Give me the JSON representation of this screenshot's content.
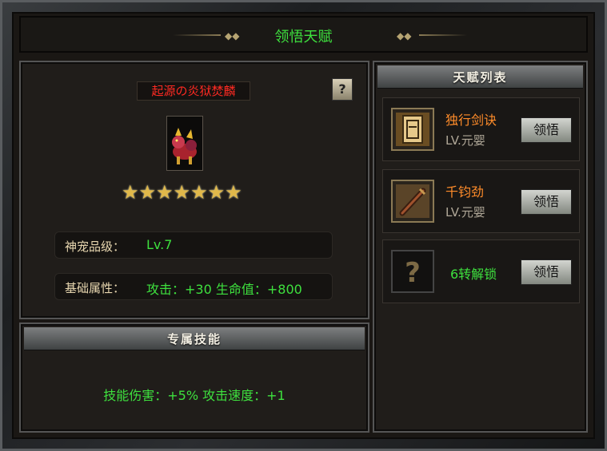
{
  "header": {
    "title": "领悟天赋"
  },
  "pet": {
    "name": "起源の炎狱焚麟",
    "stars": 7,
    "help_label": "?",
    "grade_label": "神宠品级：",
    "grade_value": "Lv.7",
    "attr_label": "基础属性：",
    "attr_value": "攻击：+30 生命值：+800"
  },
  "skill": {
    "header": "专属技能",
    "description": "技能伤害：+5% 攻击速度：+1"
  },
  "talents": {
    "header": "天赋列表",
    "items": [
      {
        "name": "独行剑诀",
        "level": "LV.元婴",
        "button": "领悟",
        "icon": "scroll-icon"
      },
      {
        "name": "千钧劲",
        "level": "LV.元婴",
        "button": "领悟",
        "icon": "sword-icon"
      },
      {
        "locked_text": "6转解锁",
        "button": "领悟",
        "icon": "question-mark-icon"
      }
    ]
  }
}
